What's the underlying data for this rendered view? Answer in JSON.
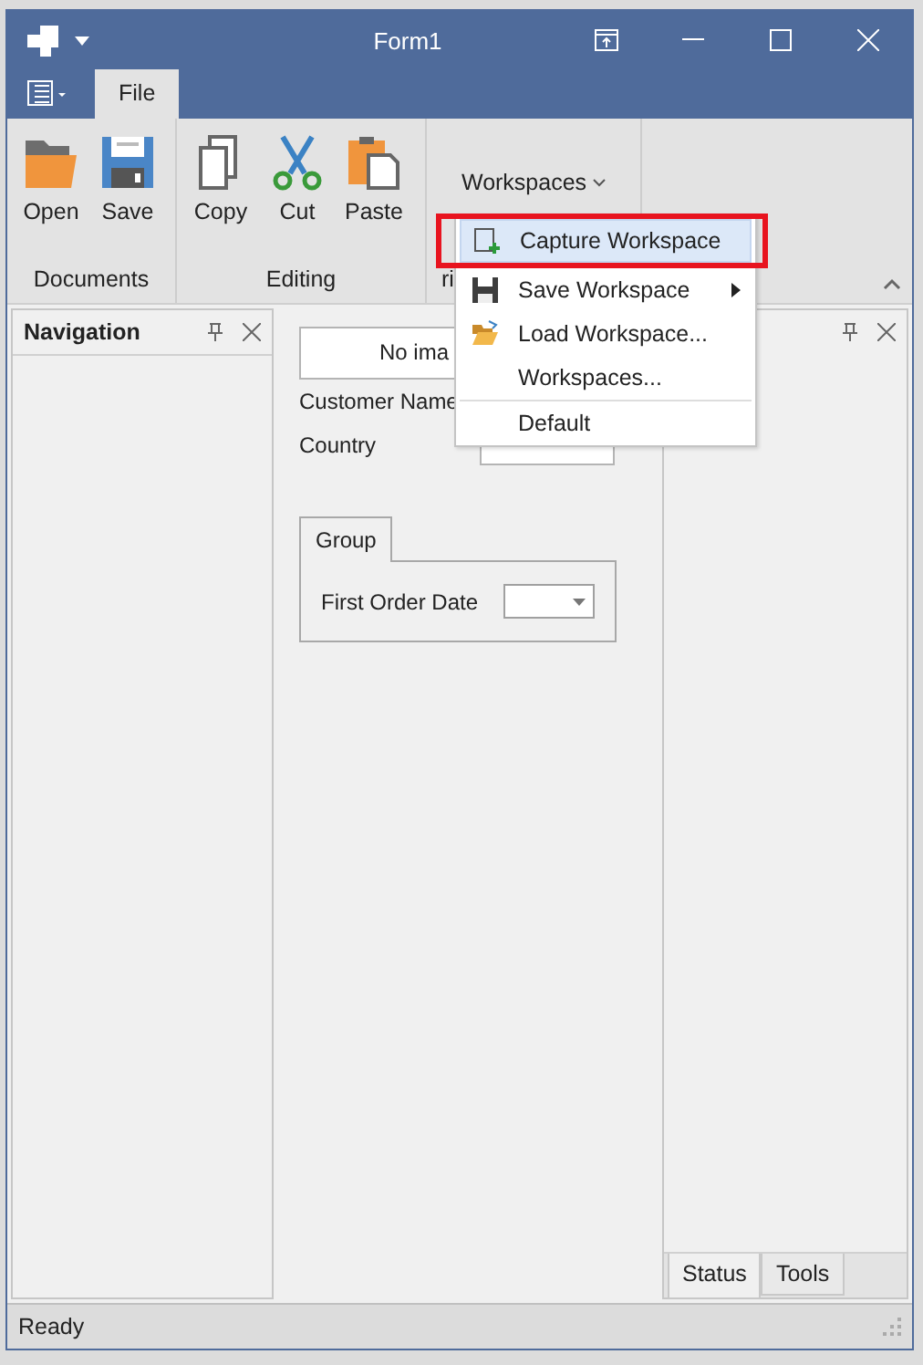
{
  "window": {
    "title": "Form1"
  },
  "ribbon": {
    "tabs": [
      {
        "label": "File",
        "selected": true
      }
    ],
    "groups": [
      {
        "label": "Documents",
        "items": [
          {
            "label": "Open",
            "kind": "open"
          },
          {
            "label": "Save",
            "kind": "save"
          }
        ]
      },
      {
        "label": "Editing",
        "items": [
          {
            "label": "Copy",
            "kind": "copy"
          },
          {
            "label": "Cut",
            "kind": "cut"
          },
          {
            "label": "Paste",
            "kind": "paste"
          }
        ]
      },
      {
        "label": "ri",
        "dropdown": "Workspaces"
      }
    ]
  },
  "menu": {
    "items": [
      {
        "label": "Capture Workspace",
        "kind": "capture",
        "selected": true,
        "highlighted": true,
        "submenu": false,
        "divider_above": false
      },
      {
        "label": "Save Workspace",
        "kind": "save",
        "selected": false,
        "highlighted": false,
        "submenu": true,
        "divider_above": false
      },
      {
        "label": "Load Workspace...",
        "kind": "load",
        "selected": false,
        "highlighted": false,
        "submenu": false,
        "divider_above": false
      },
      {
        "label": "Workspaces...",
        "kind": "plain",
        "selected": false,
        "highlighted": false,
        "submenu": false,
        "divider_above": false
      },
      {
        "label": "Default",
        "kind": "plain",
        "selected": false,
        "highlighted": false,
        "submenu": false,
        "divider_above": true
      }
    ]
  },
  "navigation_panel": {
    "title": "Navigation"
  },
  "form": {
    "image_button": "No ima",
    "fields": [
      {
        "label": "Customer Name"
      },
      {
        "label": "Country",
        "input": true
      }
    ],
    "group": {
      "tab": "Group",
      "fields": [
        {
          "label": "First Order Date"
        }
      ]
    }
  },
  "right_panel": {
    "tabs": [
      {
        "label": "Status",
        "selected": true
      },
      {
        "label": "Tools",
        "selected": false
      }
    ]
  },
  "status_bar": {
    "text": "Ready"
  }
}
